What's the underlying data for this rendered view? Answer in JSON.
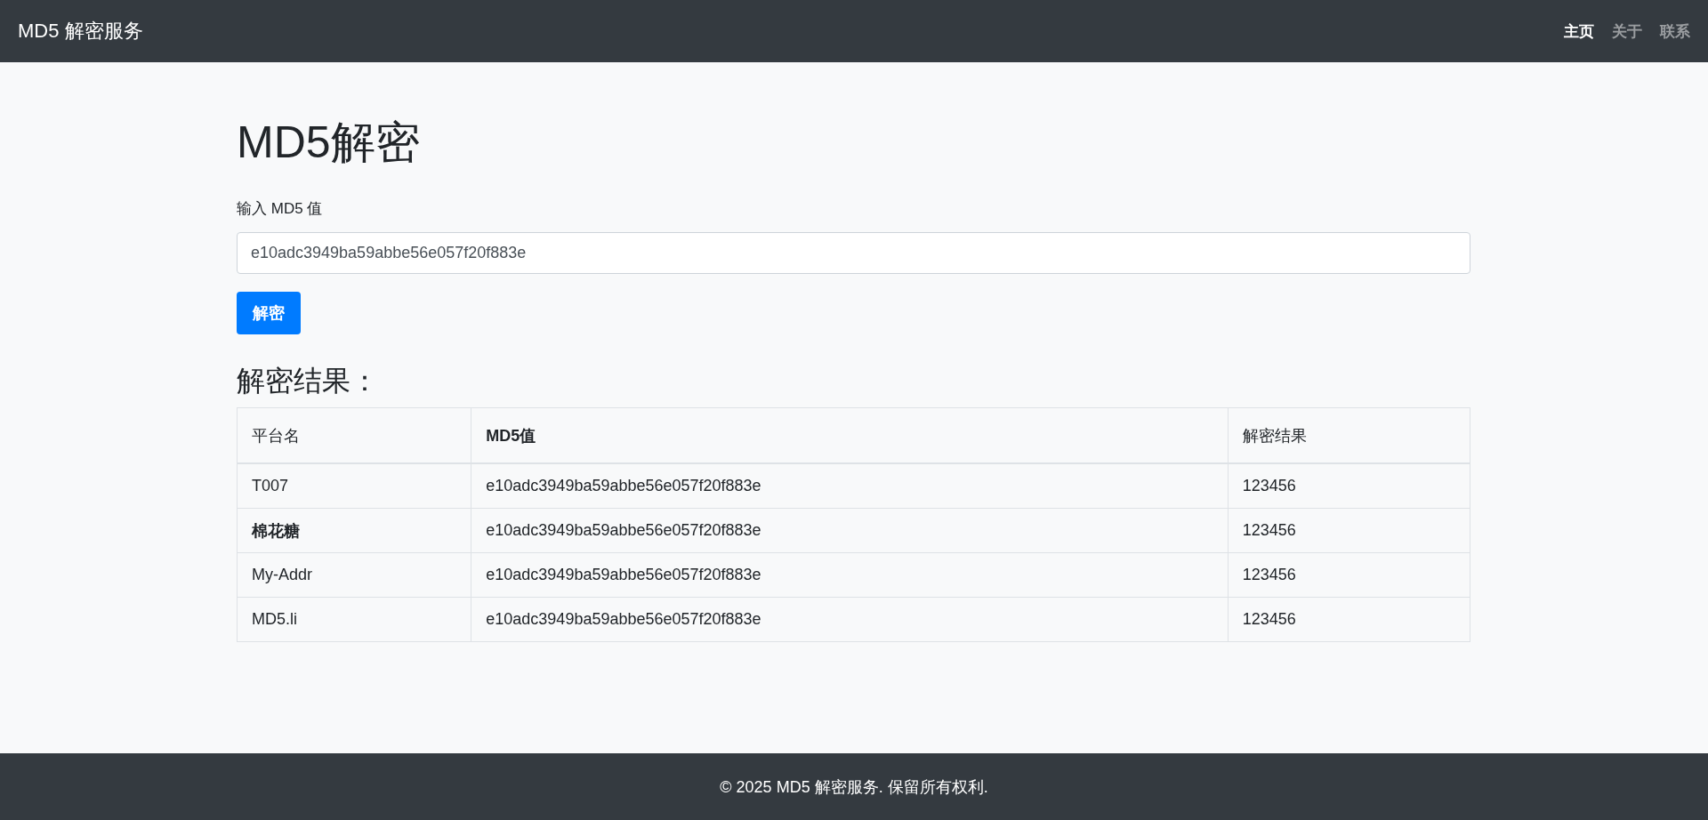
{
  "navbar": {
    "brand": "MD5 解密服务",
    "links": [
      {
        "label": "主页",
        "selected": true
      },
      {
        "label": "关于",
        "selected": false
      },
      {
        "label": "联系",
        "selected": false
      }
    ]
  },
  "title": "MD5解密",
  "form": {
    "label": "输入 MD5 值",
    "value": "e10adc3949ba59abbe56e057f20f883e",
    "button": "解密"
  },
  "results": {
    "heading": "解密结果：",
    "columns": [
      {
        "label": "平台名",
        "bold": false
      },
      {
        "label": "MD5值",
        "bold": true
      },
      {
        "label": "解密结果",
        "bold": false
      }
    ],
    "rows": [
      {
        "platform": "T007",
        "platform_bold": false,
        "md5": "e10adc3949ba59abbe56e057f20f883e",
        "result": "123456"
      },
      {
        "platform": "棉花糖",
        "platform_bold": true,
        "md5": "e10adc3949ba59abbe56e057f20f883e",
        "result": "123456"
      },
      {
        "platform": "My-Addr",
        "platform_bold": false,
        "md5": "e10adc3949ba59abbe56e057f20f883e",
        "result": "123456"
      },
      {
        "platform": "MD5.li",
        "platform_bold": false,
        "md5": "e10adc3949ba59abbe56e057f20f883e",
        "result": "123456"
      }
    ]
  },
  "footer": "© 2025 MD5 解密服务. 保留所有权利."
}
